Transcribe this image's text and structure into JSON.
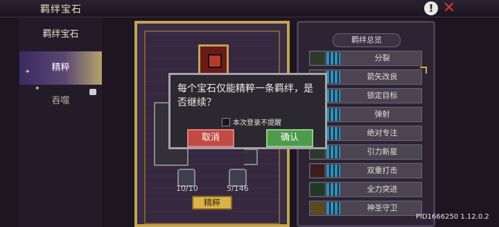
{
  "header": {
    "title": "羁绊宝石"
  },
  "sidebar": {
    "items": [
      {
        "label": "羁绊宝石"
      },
      {
        "label": "精粹"
      },
      {
        "label": "吞噬"
      }
    ]
  },
  "center": {
    "left_count": "10/10",
    "right_count": "5/146",
    "refine_button": "精粹"
  },
  "bond_list": {
    "title": "羁绊总览",
    "items": [
      {
        "label": "分裂"
      },
      {
        "label": "箭矢改良"
      },
      {
        "label": "锁定目标"
      },
      {
        "label": "弹射"
      },
      {
        "label": "绝对专注"
      },
      {
        "label": "引力新星"
      },
      {
        "label": "双重打击"
      },
      {
        "label": "全力突进"
      },
      {
        "label": "神圣守卫"
      }
    ]
  },
  "dialog": {
    "message": "每个宝石仅能精粹一条羁绊，是否继续？",
    "checkbox_label": "本次登录不提醒",
    "cancel_label": "取消",
    "confirm_label": "确认"
  },
  "footer": {
    "pid": "PID1666250 1.12.0.2"
  },
  "colors": {
    "cancel": "#c24a45",
    "confirm": "#4f9a4c",
    "accent_gold": "#c3a352"
  }
}
